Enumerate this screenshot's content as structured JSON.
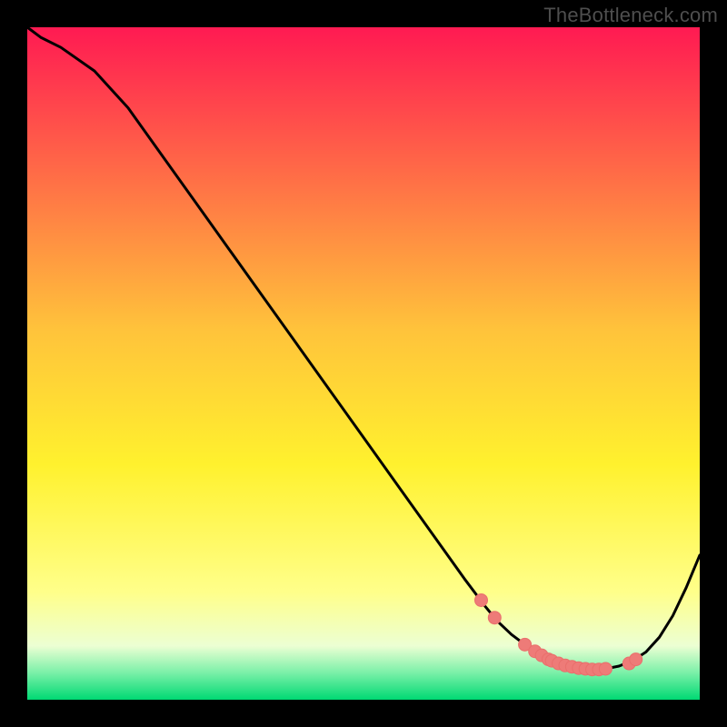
{
  "watermark": "TheBottleneck.com",
  "colors": {
    "curve_stroke": "#000000",
    "marker_fill": "#ee7b78",
    "marker_stroke": "#e96f6c",
    "gradient_top": "#ff1a52",
    "gradient_mid_top": "#ffc33b",
    "gradient_mid": "#fff12e",
    "gradient_low": "#ffff8a",
    "gradient_band": "#ecffd3",
    "gradient_green": "#00d973",
    "background": "#000000"
  },
  "chart_data": {
    "type": "line",
    "title": "",
    "xlabel": "",
    "ylabel": "",
    "xlim": [
      0,
      100
    ],
    "ylim": [
      0,
      100
    ],
    "grid": false,
    "series": [
      {
        "name": "curve",
        "x": [
          0,
          2,
          5,
          10,
          15,
          20,
          25,
          30,
          35,
          40,
          45,
          50,
          55,
          60,
          65,
          68,
          70,
          72,
          74,
          76,
          78,
          80,
          82,
          84,
          86,
          88,
          90,
          92,
          94,
          96,
          98,
          100
        ],
        "y": [
          100,
          98.5,
          97,
          93.5,
          88,
          81,
          74,
          67,
          60,
          53,
          46,
          39,
          32,
          25,
          18,
          14,
          11.6,
          9.7,
          8.2,
          6.8,
          5.7,
          5.0,
          4.6,
          4.5,
          4.6,
          5.0,
          5.8,
          7.1,
          9.3,
          12.5,
          16.7,
          21.5
        ]
      }
    ],
    "markers": {
      "name": "highlight-points",
      "x": [
        67.5,
        69.5,
        74.0,
        75.5,
        76.5,
        77.5,
        78.0,
        79.0,
        80.0,
        81.0,
        82.0,
        83.0,
        84.0,
        85.0,
        86.0,
        89.5,
        90.5
      ],
      "y": [
        14.8,
        12.2,
        8.2,
        7.2,
        6.6,
        6.0,
        5.8,
        5.4,
        5.1,
        4.9,
        4.7,
        4.6,
        4.5,
        4.5,
        4.6,
        5.4,
        6.0
      ]
    }
  }
}
